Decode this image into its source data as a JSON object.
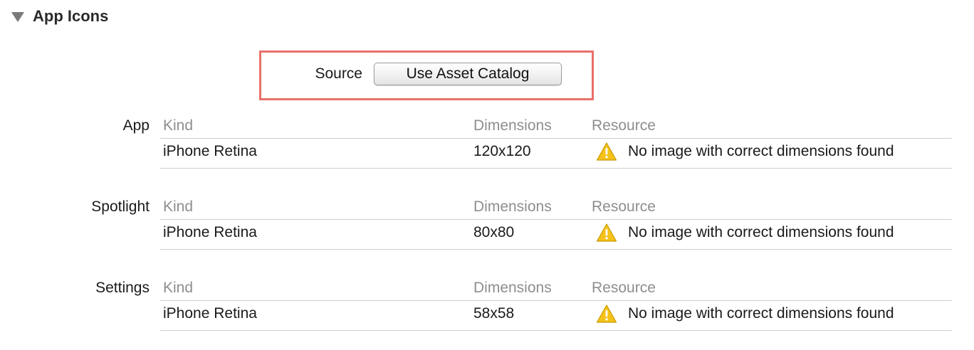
{
  "section": {
    "title": "App Icons"
  },
  "source": {
    "label": "Source",
    "button_label": "Use Asset Catalog"
  },
  "columns": {
    "kind": "Kind",
    "dimensions": "Dimensions",
    "resource": "Resource"
  },
  "groups": [
    {
      "label": "App",
      "kind": "iPhone Retina",
      "dimensions": "120x120",
      "resource": "No image with correct dimensions found",
      "resource_icon": "warning-icon"
    },
    {
      "label": "Spotlight",
      "kind": "iPhone Retina",
      "dimensions": "80x80",
      "resource": "No image with correct dimensions found",
      "resource_icon": "warning-icon"
    },
    {
      "label": "Settings",
      "kind": "iPhone Retina",
      "dimensions": "58x58",
      "resource": "No image with correct dimensions found",
      "resource_icon": "warning-icon"
    }
  ],
  "colors": {
    "highlight_border": "#e8706a",
    "warning_fill": "#f5c21b",
    "header_text": "#8e8e8e"
  }
}
